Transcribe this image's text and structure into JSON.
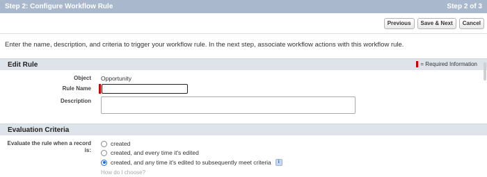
{
  "header": {
    "title": "Step 2: Configure Workflow Rule",
    "step": "Step 2 of 3"
  },
  "toolbar": {
    "previous_label": "Previous",
    "save_next_label": "Save & Next",
    "cancel_label": "Cancel"
  },
  "intro_text": "Enter the name, description, and criteria to trigger your workflow rule. In the next step, associate workflow actions with this workflow rule.",
  "edit_rule": {
    "section_title": "Edit Rule",
    "required_legend": "= Required Information",
    "object_label": "Object",
    "object_value": "Opportunity",
    "rule_name_label": "Rule Name",
    "rule_name_value": "",
    "description_label": "Description",
    "description_value": ""
  },
  "evaluation": {
    "section_title": "Evaluation Criteria",
    "label": "Evaluate the rule when a record is:",
    "options": [
      {
        "label": "created",
        "checked": false
      },
      {
        "label": "created, and every time it's edited",
        "checked": false
      },
      {
        "label": "created, and any time it's edited to subsequently meet criteria",
        "checked": true
      }
    ],
    "info_icon": "info-icon",
    "help_link": "How do I choose?"
  },
  "colors": {
    "header_bg": "#a9b8cc",
    "section_bg": "#dfe4ea",
    "required_red": "#cc0000",
    "radio_selected": "#1a6fd8"
  }
}
